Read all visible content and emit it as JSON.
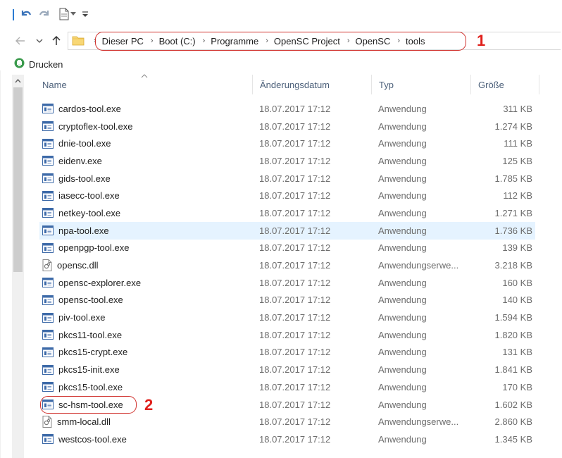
{
  "breadcrumb": [
    "Dieser PC",
    "Boot (C:)",
    "Programme",
    "OpenSC Project",
    "OpenSC",
    "tools"
  ],
  "command": {
    "print_label": "Drucken"
  },
  "columns": {
    "name": "Name",
    "date": "Änderungsdatum",
    "type": "Typ",
    "size": "Größe"
  },
  "files": [
    {
      "name": "cardos-tool.exe",
      "date": "18.07.2017 17:12",
      "type": "Anwendung",
      "size": "311 KB",
      "icon": "exe-icon"
    },
    {
      "name": "cryptoflex-tool.exe",
      "date": "18.07.2017 17:12",
      "type": "Anwendung",
      "size": "1.274 KB",
      "icon": "exe-icon"
    },
    {
      "name": "dnie-tool.exe",
      "date": "18.07.2017 17:12",
      "type": "Anwendung",
      "size": "111 KB",
      "icon": "exe-icon"
    },
    {
      "name": "eidenv.exe",
      "date": "18.07.2017 17:12",
      "type": "Anwendung",
      "size": "125 KB",
      "icon": "exe-icon"
    },
    {
      "name": "gids-tool.exe",
      "date": "18.07.2017 17:12",
      "type": "Anwendung",
      "size": "1.785 KB",
      "icon": "exe-icon"
    },
    {
      "name": "iasecc-tool.exe",
      "date": "18.07.2017 17:12",
      "type": "Anwendung",
      "size": "112 KB",
      "icon": "exe-icon"
    },
    {
      "name": "netkey-tool.exe",
      "date": "18.07.2017 17:12",
      "type": "Anwendung",
      "size": "1.271 KB",
      "icon": "exe-icon"
    },
    {
      "name": "npa-tool.exe",
      "date": "18.07.2017 17:12",
      "type": "Anwendung",
      "size": "1.736 KB",
      "icon": "exe-icon"
    },
    {
      "name": "openpgp-tool.exe",
      "date": "18.07.2017 17:12",
      "type": "Anwendung",
      "size": "139 KB",
      "icon": "exe-icon"
    },
    {
      "name": "opensc.dll",
      "date": "18.07.2017 17:12",
      "type": "Anwendungserwe...",
      "size": "3.218 KB",
      "icon": "dll-icon"
    },
    {
      "name": "opensc-explorer.exe",
      "date": "18.07.2017 17:12",
      "type": "Anwendung",
      "size": "160 KB",
      "icon": "exe-icon"
    },
    {
      "name": "opensc-tool.exe",
      "date": "18.07.2017 17:12",
      "type": "Anwendung",
      "size": "140 KB",
      "icon": "exe-icon"
    },
    {
      "name": "piv-tool.exe",
      "date": "18.07.2017 17:12",
      "type": "Anwendung",
      "size": "1.594 KB",
      "icon": "exe-icon"
    },
    {
      "name": "pkcs11-tool.exe",
      "date": "18.07.2017 17:12",
      "type": "Anwendung",
      "size": "1.820 KB",
      "icon": "exe-icon"
    },
    {
      "name": "pkcs15-crypt.exe",
      "date": "18.07.2017 17:12",
      "type": "Anwendung",
      "size": "131 KB",
      "icon": "exe-icon"
    },
    {
      "name": "pkcs15-init.exe",
      "date": "18.07.2017 17:12",
      "type": "Anwendung",
      "size": "1.841 KB",
      "icon": "exe-icon"
    },
    {
      "name": "pkcs15-tool.exe",
      "date": "18.07.2017 17:12",
      "type": "Anwendung",
      "size": "170 KB",
      "icon": "exe-icon"
    },
    {
      "name": "sc-hsm-tool.exe",
      "date": "18.07.2017 17:12",
      "type": "Anwendung",
      "size": "1.602 KB",
      "icon": "exe-icon"
    },
    {
      "name": "smm-local.dll",
      "date": "18.07.2017 17:12",
      "type": "Anwendungserwe...",
      "size": "2.860 KB",
      "icon": "dll-icon"
    },
    {
      "name": "westcos-tool.exe",
      "date": "18.07.2017 17:12",
      "type": "Anwendung",
      "size": "1.345 KB",
      "icon": "exe-icon"
    }
  ],
  "hovered_file_index": 7,
  "annotations": {
    "address_marker": "1",
    "file_marker": "2"
  },
  "colors": {
    "annotation_red": "#e0201b",
    "hover_row": "#e5f3ff",
    "header_text": "#4c607a"
  }
}
